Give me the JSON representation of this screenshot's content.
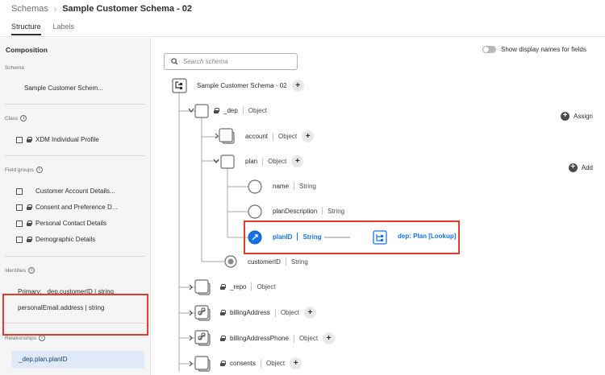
{
  "breadcrumb": {
    "parent": "Schemas",
    "current": "Sample Customer Schema - 02"
  },
  "tabs": [
    {
      "label": "Structure",
      "active": true
    },
    {
      "label": "Labels",
      "active": false
    }
  ],
  "composition": {
    "title": "Composition",
    "schema_label": "Schema",
    "schema_name": "Sample Customer Schem...",
    "class_label": "Class",
    "assign_label": "Assign",
    "class_name": "XDM Individual Profile",
    "fieldgroups_label": "Field groups",
    "add_label": "Add",
    "field_groups": [
      {
        "name": "Customer Account Details...",
        "locked": false
      },
      {
        "name": "Consent and Preference D...",
        "locked": true
      },
      {
        "name": "Personal Contact Details",
        "locked": true
      },
      {
        "name": "Demographic Details",
        "locked": true
      }
    ],
    "identities_label": "Identities",
    "identities": [
      "Primary: _dep.customerID | string",
      "personalEmail.address | string"
    ],
    "relationships_label": "Relationships",
    "relationships": [
      "_dep.plan.planID"
    ]
  },
  "search": {
    "placeholder": "Search schema"
  },
  "toggle_label": "Show display names for fields",
  "tree": {
    "root": "Sample Customer Schema - 02",
    "nodes": {
      "dep": {
        "name": "_dep",
        "type": "Object"
      },
      "account": {
        "name": "account",
        "type": "Object"
      },
      "plan": {
        "name": "plan",
        "type": "Object"
      },
      "name": {
        "name": "name",
        "type": "String"
      },
      "planDescription": {
        "name": "planDescription",
        "type": "String"
      },
      "planID": {
        "name": "planID",
        "type": "String",
        "relationship": "dep: Plan [Lookup]"
      },
      "customerID": {
        "name": "customerID",
        "type": "String"
      },
      "repo": {
        "name": "_repo",
        "type": "Object"
      },
      "billingAddress": {
        "name": "billingAddress",
        "type": "Object"
      },
      "billingAddressPhone": {
        "name": "billingAddressPhone",
        "type": "Object"
      },
      "consents": {
        "name": "consents",
        "type": "Object"
      }
    }
  },
  "colors": {
    "accent": "#1473e6",
    "highlight": "#e5392a",
    "relationship_bg": "#dfe9f7"
  }
}
